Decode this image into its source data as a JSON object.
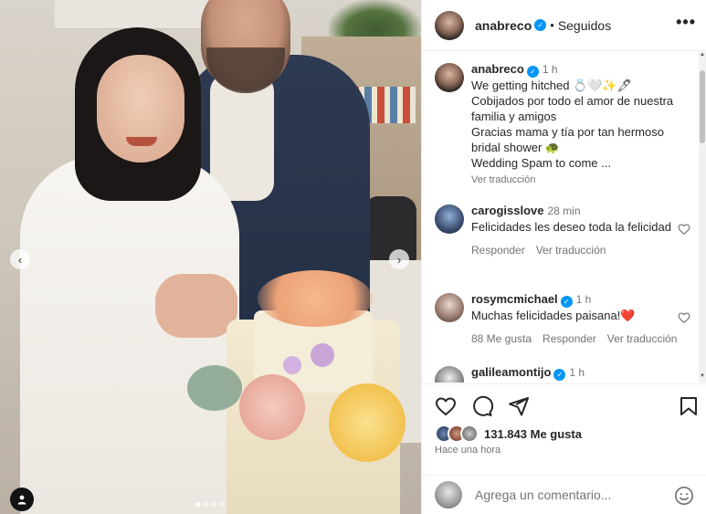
{
  "post": {
    "username": "anabreco",
    "follow_state": "Seguidos",
    "more_label": "•••"
  },
  "caption": {
    "username": "anabreco",
    "time": "1 h",
    "lines": [
      "We getting hitched 💍🤍✨🖊",
      "Cobijados por todo el amor de nuestra",
      "familia y amigos",
      "Gracias mama y tía por tan hermoso",
      "bridal shower 🐢",
      "Wedding Spam to come ..."
    ],
    "translate_label": "Ver traducción"
  },
  "comments": [
    {
      "username": "carogisslove",
      "time": "28 min",
      "text": "Felicidades les deseo toda la felicidad",
      "reply_label": "Responder",
      "translate_label": "Ver traducción",
      "likes_label": ""
    },
    {
      "username": "rosymcmichael",
      "time": "1 h",
      "text": "Muchas felicidades paisana!❤️",
      "likes_label": "88 Me gusta",
      "reply_label": "Responder",
      "translate_label": "Ver traducción"
    },
    {
      "username": "galileamontijo",
      "time": "1 h"
    }
  ],
  "engagement": {
    "likes_count": "131.843",
    "likes_suffix": "Me gusta",
    "posted_ago": "Hace una hora"
  },
  "composer": {
    "placeholder": "Agrega un comentario..."
  },
  "carousel": {
    "slide_count": 4,
    "active_index": 0
  },
  "colors": {
    "verified": "#0095f6",
    "heart_red": "#ed4956",
    "meta_gray": "#737373"
  },
  "icons": [
    "chevron-left-icon",
    "chevron-right-icon",
    "user-tag-icon",
    "heart-icon",
    "comment-icon",
    "share-icon",
    "bookmark-icon",
    "emoji-icon",
    "verified-icon",
    "more-icon"
  ]
}
